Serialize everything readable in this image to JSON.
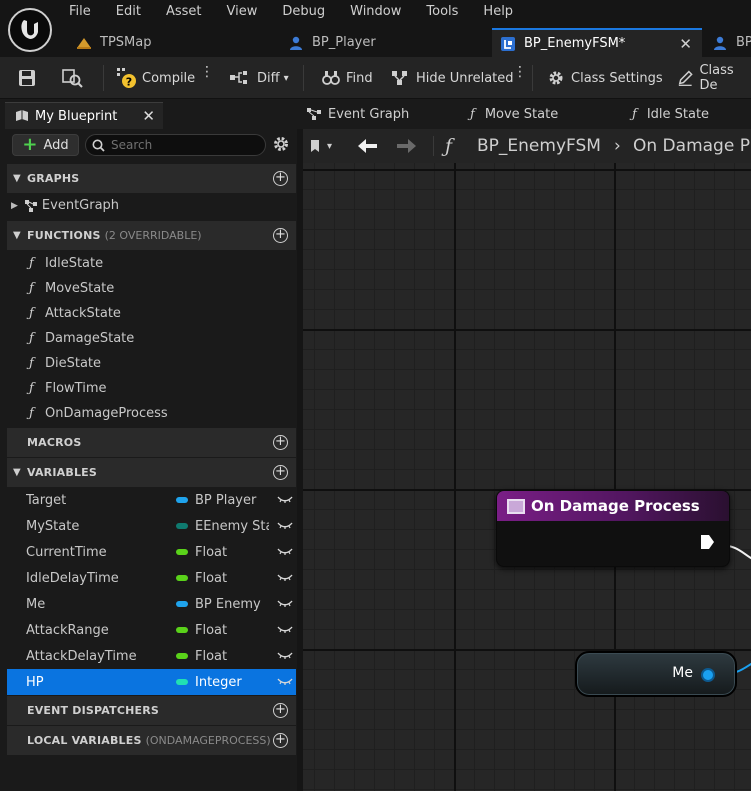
{
  "menu": [
    "File",
    "Edit",
    "Asset",
    "View",
    "Debug",
    "Window",
    "Tools",
    "Help"
  ],
  "tabs": [
    {
      "label": "TPSMap"
    },
    {
      "label": "BP_Player"
    },
    {
      "label": "BP_EnemyFSM*"
    },
    {
      "label": "BP"
    }
  ],
  "toolbar": {
    "compile": "Compile",
    "diff": "Diff",
    "find": "Find",
    "hide_unrelated": "Hide Unrelated",
    "class_settings": "Class Settings",
    "class_defaults": "Class De"
  },
  "panel": {
    "title": "My Blueprint",
    "add_label": "Add",
    "search_placeholder": "Search"
  },
  "sections": {
    "graphs": "GRAPHS",
    "functions": "FUNCTIONS",
    "functions_note": "(2 OVERRIDABLE)",
    "macros": "MACROS",
    "variables": "VARIABLES",
    "event_dispatchers": "EVENT DISPATCHERS",
    "local_variables": "LOCAL VARIABLES",
    "local_variables_note": "(ONDAMAGEPROCESS)"
  },
  "graphs": [
    "EventGraph"
  ],
  "functions": [
    "IdleState",
    "MoveState",
    "AttackState",
    "DamageState",
    "DieState",
    "FlowTime",
    "OnDamageProcess"
  ],
  "variables": [
    {
      "name": "Target",
      "type": "BP Player",
      "color": "#1fa3ec"
    },
    {
      "name": "MyState",
      "type": "EEnemy State",
      "color": "#0f7a6f"
    },
    {
      "name": "CurrentTime",
      "type": "Float",
      "color": "#5ad21a"
    },
    {
      "name": "IdleDelayTime",
      "type": "Float",
      "color": "#5ad21a"
    },
    {
      "name": "Me",
      "type": "BP Enemy",
      "color": "#1fa3ec"
    },
    {
      "name": "AttackRange",
      "type": "Float",
      "color": "#5ad21a"
    },
    {
      "name": "AttackDelayTime",
      "type": "Float",
      "color": "#5ad21a"
    },
    {
      "name": "HP",
      "type": "Integer",
      "color": "#21e0b3"
    }
  ],
  "selected_variable": "HP",
  "graph_tabs": [
    "Event Graph",
    "Move State",
    "Idle State"
  ],
  "breadcrumb": {
    "blueprint": "BP_EnemyFSM",
    "function": "On Damage P"
  },
  "nodes": {
    "event_title": "On Damage Process",
    "me_label": "Me"
  },
  "colors": {
    "accent": "#1b78e0",
    "selection": "#0a74e0",
    "function_node": "#7a1e86",
    "object_pin": "#1aa0f0"
  }
}
